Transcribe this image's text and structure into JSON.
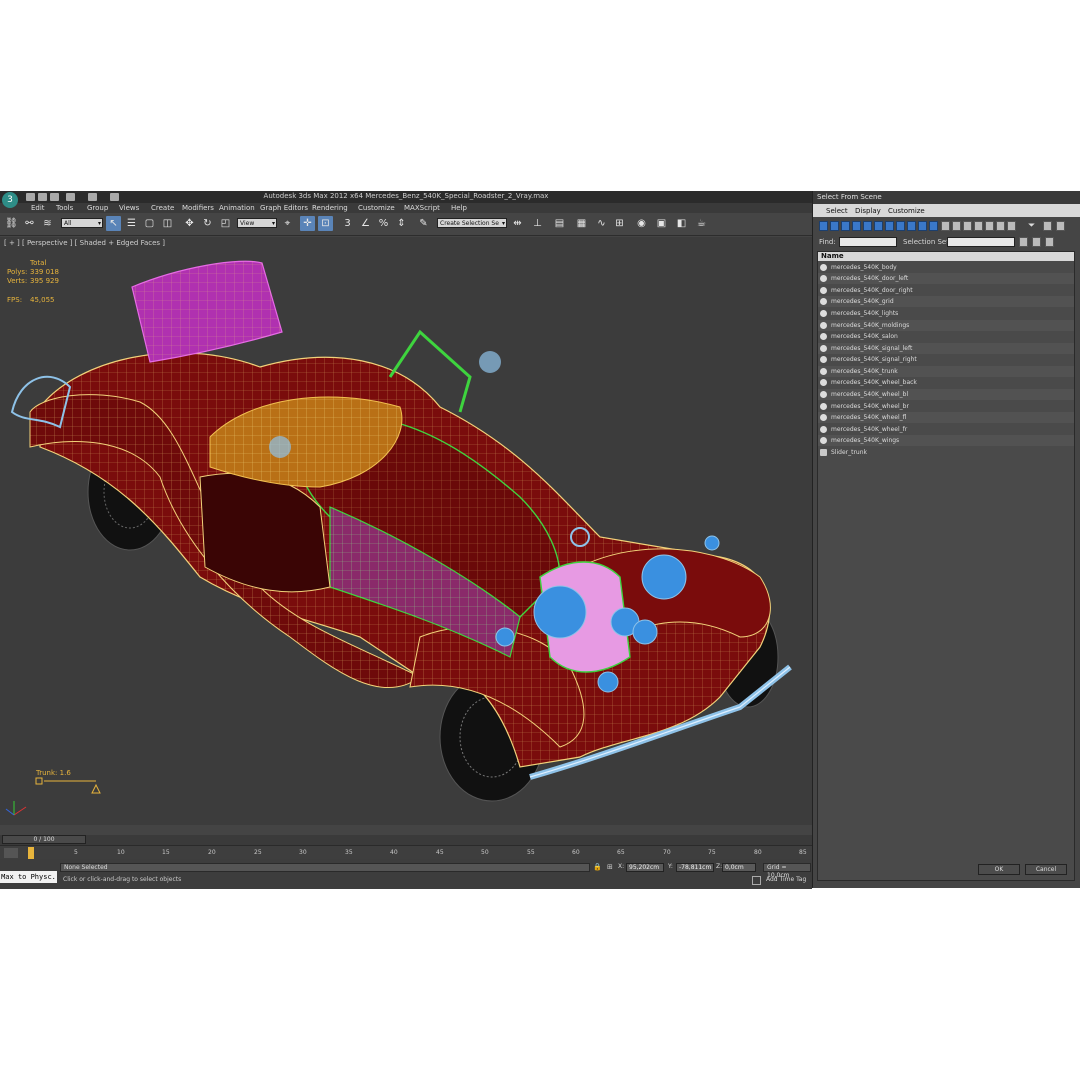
{
  "window": {
    "title": "Autodesk 3ds Max  2012 x64      Mercedes_Benz_540K_Special_Roadster_2_Vray.max",
    "logo": "3"
  },
  "menu": [
    "Edit",
    "Tools",
    "Group",
    "Views",
    "Create",
    "Modifiers",
    "Animation",
    "Graph Editors",
    "Rendering",
    "Customize",
    "MAXScript",
    "Help"
  ],
  "toolbar": {
    "selection_filter": "All",
    "reference_coord": "View",
    "named_selection": "Create Selection Se",
    "icons": [
      "link-icon",
      "unlink-icon",
      "bind-space-warp-icon",
      "select-object-icon",
      "select-by-name-icon",
      "rectangle-region-icon",
      "window-crossing-icon",
      "move-icon",
      "rotate-icon",
      "scale-icon",
      "pivot-icon",
      "snap-icon",
      "angle-snap-icon",
      "percent-snap-icon",
      "spinner-snap-icon",
      "mirror-icon",
      "align-icon",
      "layer-icon",
      "curve-editor-icon",
      "schematic-icon",
      "material-editor-icon",
      "render-setup-icon",
      "render-frame-icon",
      "render-icon",
      "teapot-icon"
    ]
  },
  "viewport": {
    "label": "[ + ] [ Perspective ] [ Shaded + Edged Faces ]",
    "stats": {
      "total_label": "Total",
      "polys_label": "Polys:",
      "polys_value": "339 018",
      "verts_label": "Verts:",
      "verts_value": "395 929",
      "fps_label": "FPS:",
      "fps_value": "45,055"
    },
    "trunk_label": "Trunk: 1.6",
    "trunk_value": 1.6
  },
  "timeline": {
    "slider": "0 / 100",
    "ticks": [
      "5",
      "10",
      "15",
      "20",
      "25",
      "30",
      "35",
      "40",
      "45",
      "50",
      "55",
      "60",
      "65",
      "70",
      "75",
      "80",
      "85"
    ]
  },
  "status": {
    "script_listener": "Max to Physc.",
    "selection": "None Selected",
    "prompt": "Click or click-and-drag to select objects",
    "x_label": "X:",
    "x_value": "95,202cm",
    "y_label": "Y:",
    "y_value": "-78,811cm",
    "z_label": "Z:",
    "z_value": "0,0cm",
    "grid": "Grid = 10,0cm",
    "add_time_tag": "Add Time Tag"
  },
  "dialog": {
    "title": "Select From Scene",
    "menu": [
      "Select",
      "Display",
      "Customize"
    ],
    "find_label": "Find:",
    "selection_sets_label": "Selection Set:",
    "column_header": "Name",
    "items": [
      "mercedes_540K_body",
      "mercedes_540K_door_left",
      "mercedes_540K_door_right",
      "mercedes_540K_grid",
      "mercedes_540K_lights",
      "mercedes_540K_moldings",
      "mercedes_540K_salon",
      "mercedes_540K_signal_left",
      "mercedes_540K_signal_right",
      "mercedes_540K_trunk",
      "mercedes_540K_wheel_back",
      "mercedes_540K_wheel_bl",
      "mercedes_540K_wheel_br",
      "mercedes_540K_wheel_fl",
      "mercedes_540K_wheel_fr",
      "mercedes_540K_wings",
      "Slider_trunk"
    ],
    "ok_label": "OK",
    "cancel_label": "Cancel"
  },
  "colors": {
    "body": "#7a0c0c",
    "wire": "#f2d27a",
    "chrome": "#8ec2e8",
    "green_parts": "#3ed43e",
    "seat": "#d04cd0",
    "lights": "#3a90e0",
    "stats_text": "#e7b43c"
  }
}
